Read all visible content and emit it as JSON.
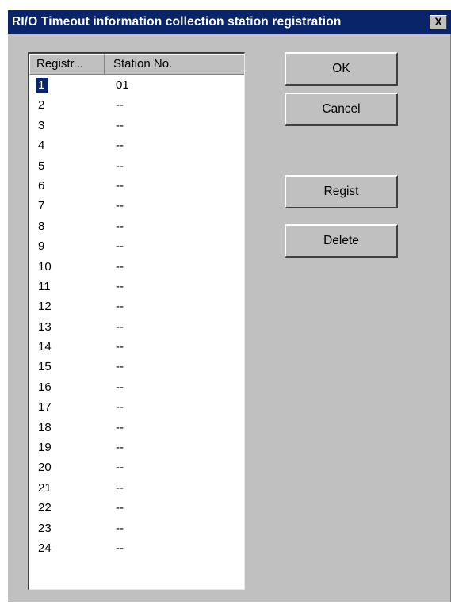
{
  "window": {
    "title": "RI/O Timeout information collection station registration",
    "close_label": "X"
  },
  "list": {
    "columns": [
      "Registr...",
      "Station No."
    ],
    "rows": [
      {
        "reg": "1",
        "station": "01",
        "selected": true
      },
      {
        "reg": "2",
        "station": "--"
      },
      {
        "reg": "3",
        "station": "--"
      },
      {
        "reg": "4",
        "station": "--"
      },
      {
        "reg": "5",
        "station": "--"
      },
      {
        "reg": "6",
        "station": "--"
      },
      {
        "reg": "7",
        "station": "--"
      },
      {
        "reg": "8",
        "station": "--"
      },
      {
        "reg": "9",
        "station": "--"
      },
      {
        "reg": "10",
        "station": "--"
      },
      {
        "reg": "11",
        "station": "--"
      },
      {
        "reg": "12",
        "station": "--"
      },
      {
        "reg": "13",
        "station": "--"
      },
      {
        "reg": "14",
        "station": "--"
      },
      {
        "reg": "15",
        "station": "--"
      },
      {
        "reg": "16",
        "station": "--"
      },
      {
        "reg": "17",
        "station": "--"
      },
      {
        "reg": "18",
        "station": "--"
      },
      {
        "reg": "19",
        "station": "--"
      },
      {
        "reg": "20",
        "station": "--"
      },
      {
        "reg": "21",
        "station": "--"
      },
      {
        "reg": "22",
        "station": "--"
      },
      {
        "reg": "23",
        "station": "--"
      },
      {
        "reg": "24",
        "station": "--"
      }
    ]
  },
  "buttons": {
    "ok": "OK",
    "cancel": "Cancel",
    "regist": "Regist",
    "delete": "Delete"
  },
  "colors": {
    "titlebar": "#0a246a",
    "face": "#c0c0c0",
    "selection": "#0a246a"
  }
}
